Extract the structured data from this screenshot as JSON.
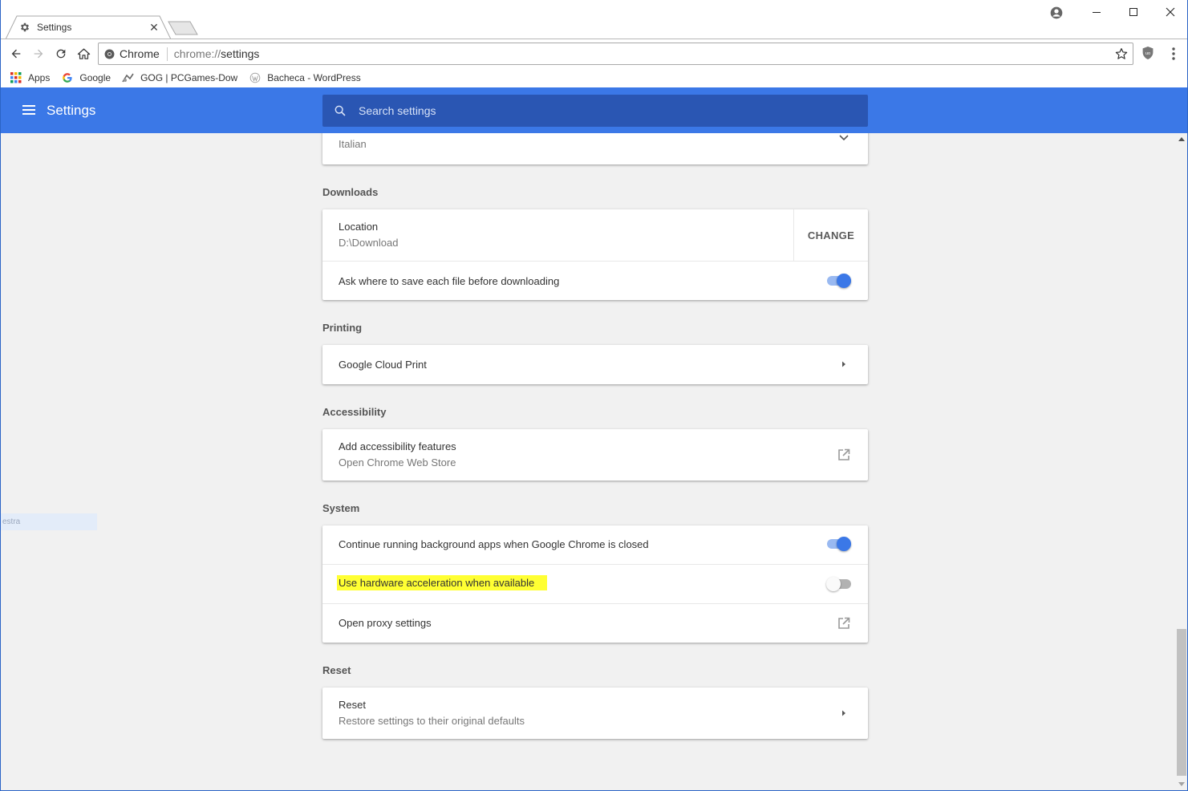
{
  "tab": {
    "title": "Settings",
    "close": "✕"
  },
  "omnibox": {
    "secure_label": "Chrome",
    "url_scheme": "chrome://",
    "url_path": "settings"
  },
  "bookmarks": [
    {
      "label": "Apps",
      "icon": "apps-grid-icon"
    },
    {
      "label": "Google",
      "icon": "google-g-icon"
    },
    {
      "label": "GOG | PCGames-Dow",
      "icon": "gog-icon"
    },
    {
      "label": "Bacheca - WordPress",
      "icon": "wordpress-icon"
    }
  ],
  "appbar": {
    "title": "Settings",
    "search_placeholder": "Search settings"
  },
  "left_ghost": "estra",
  "spellcheck": {
    "value": "Italian"
  },
  "downloads": {
    "section": "Downloads",
    "location_label": "Location",
    "location_value": "D:\\Download",
    "change": "CHANGE",
    "ask_label": "Ask where to save each file before downloading",
    "ask_on": true
  },
  "printing": {
    "section": "Printing",
    "cloud_print": "Google Cloud Print"
  },
  "accessibility": {
    "section": "Accessibility",
    "label": "Add accessibility features",
    "sub": "Open Chrome Web Store"
  },
  "system": {
    "section": "System",
    "background_label": "Continue running background apps when Google Chrome is closed",
    "background_on": true,
    "hw_label": "Use hardware acceleration when available",
    "hw_on": false,
    "proxy_label": "Open proxy settings"
  },
  "reset": {
    "section": "Reset",
    "label": "Reset",
    "sub": "Restore settings to their original defaults"
  },
  "colors": {
    "accent": "#3b78e7",
    "search_bg": "#2a56b3",
    "highlight": "#ffff33"
  }
}
